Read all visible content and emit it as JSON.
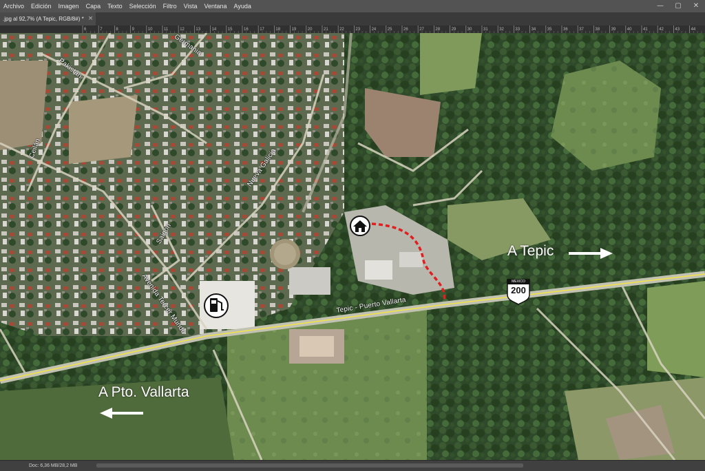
{
  "app": {
    "menu": [
      "Archivo",
      "Edición",
      "Imagen",
      "Capa",
      "Texto",
      "Selección",
      "Filtro",
      "Vista",
      "Ventana",
      "Ayuda"
    ]
  },
  "document": {
    "tab_title": ".jpg al 92,7% (A Tepic, RGB/8#) *",
    "tab_close": "×"
  },
  "window_controls": [
    "—",
    "▢",
    "✕"
  ],
  "ruler": {
    "ticks": [
      "6",
      "7",
      "8",
      "9",
      "10",
      "11",
      "12",
      "13",
      "14",
      "15",
      "16",
      "17",
      "18",
      "19",
      "20",
      "21",
      "22",
      "23",
      "24",
      "25",
      "26",
      "27",
      "28",
      "29",
      "30",
      "31",
      "32",
      "33",
      "34",
      "35",
      "36",
      "37",
      "38",
      "39",
      "40",
      "41",
      "42",
      "43",
      "44",
      "45"
    ]
  },
  "map": {
    "streets": {
      "germania": "Germania",
      "pakistan": "Pakistán",
      "ceilan": "Ceilán",
      "nueva_galicia": "Nueva Galicia",
      "saigon": "Saigon",
      "avenida_tercer_mundo": "Avenida Tercer Mundo",
      "highway": "Tepic - Puerto Vallarta"
    },
    "labels": {
      "a_tepic": "A Tepic",
      "a_pto_vallarta": "A Pto. Vallarta"
    },
    "shield": {
      "top": "MEXICO",
      "number": "200"
    },
    "icons": {
      "house": "house-icon",
      "gas": "gas-station-icon"
    },
    "colors": {
      "route": "#e02020",
      "road": "#d8d890",
      "highway_line": "#f0e24a"
    }
  },
  "status": {
    "zoom": "",
    "doc_size": "Doc: 6,36 MB/28,2 MB"
  }
}
